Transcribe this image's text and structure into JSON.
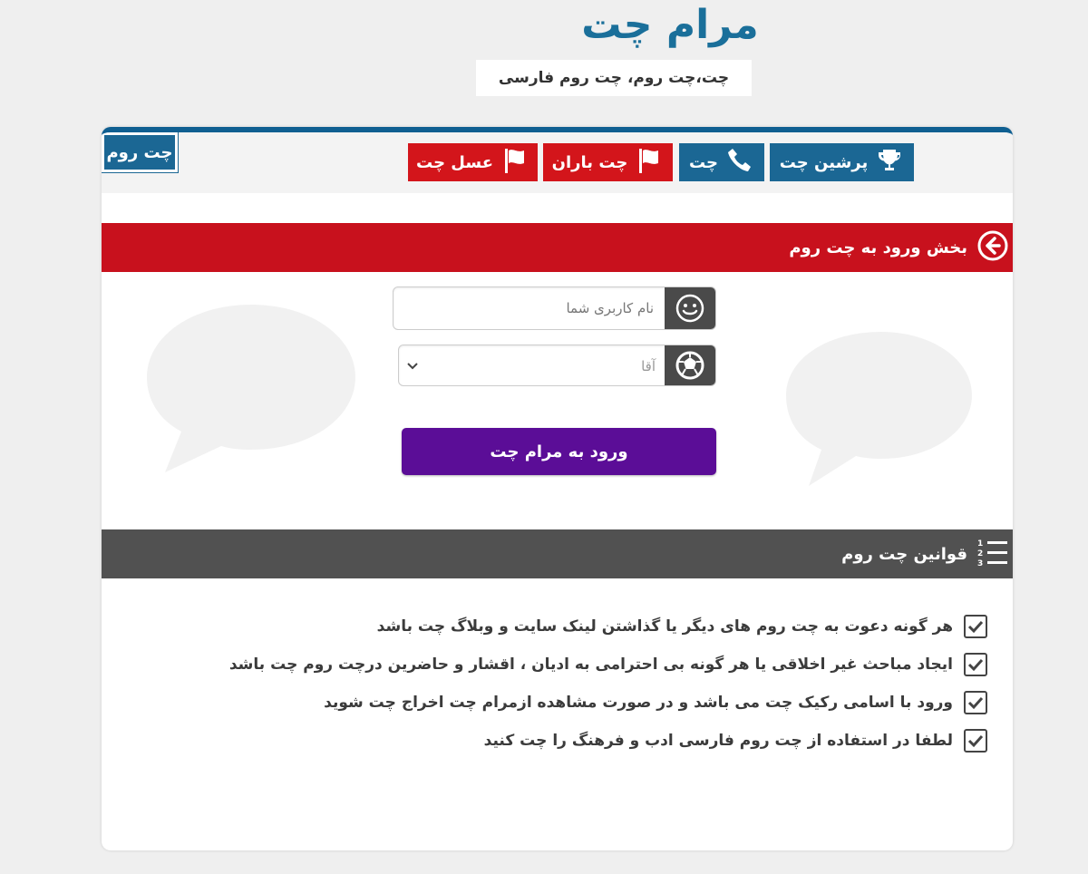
{
  "header": {
    "site_title": "مرام چت",
    "tagline": "چت،چت روم، چت روم فارسی"
  },
  "tabs": [
    {
      "label": "چت روم",
      "icon": "none",
      "color": "#1b6794"
    },
    {
      "label": "پرشین چت",
      "icon": "trophy-icon",
      "color": "#1b6794"
    },
    {
      "label": "چت",
      "icon": "phone-icon",
      "color": "#1b6794"
    },
    {
      "label": "چت باران",
      "icon": "flag-icon",
      "color": "#d3151b"
    },
    {
      "label": "عسل چت",
      "icon": "flag-icon",
      "color": "#d3151b"
    }
  ],
  "login": {
    "section_title": "بخش ورود به چت روم",
    "username_placeholder": "نام کاربری شما",
    "gender_selected": "آقا",
    "submit_label": "ورود به مرام چت"
  },
  "rules": {
    "section_title": "قوانین چت روم",
    "items": [
      "هر گونه دعوت به چت روم های دیگر یا گذاشتن لینک سایت و وبلاگ چت باشد",
      "ایجاد مباحث غیر اخلاقی یا هر گونه بی احترامی به ادیان ، اقشار و حاضرین درچت روم چت باشد",
      "ورود با اسامی رکیک چت می باشد و در صورت مشاهده ازمرام چت اخراج چت شوید",
      "لطفا در استفاده از چت روم فارسی ادب و فرهنگ را چت کنید"
    ]
  },
  "colors": {
    "brand_blue": "#1b6794",
    "brand_red": "#c8111d",
    "submit_purple": "#5b0d97",
    "rules_bar_gray": "#515151"
  }
}
